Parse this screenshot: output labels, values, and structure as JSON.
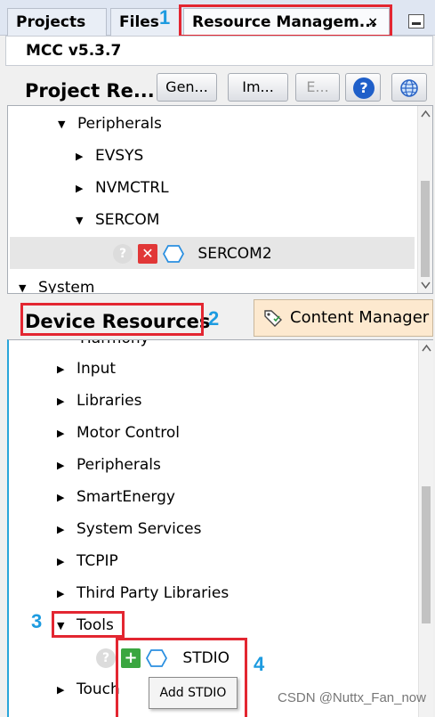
{
  "tabs": [
    {
      "label": "Projects"
    },
    {
      "label": "Files"
    },
    {
      "label": "Resource Managem...",
      "close": "×",
      "active": true
    }
  ],
  "version": "MCC v5.3.7",
  "project_resources": {
    "title": "Project Re...",
    "buttons": [
      {
        "label": "Gen...",
        "enabled": true
      },
      {
        "label": "Im...",
        "enabled": true
      },
      {
        "label": "E...",
        "enabled": false
      }
    ],
    "icons": [
      "help-icon",
      "globe-icon"
    ],
    "help_glyph": "?",
    "tree": [
      {
        "label": "Peripherals",
        "expanded": true
      },
      {
        "label": "EVSYS",
        "expanded": false
      },
      {
        "label": "NVMCTRL",
        "expanded": false
      },
      {
        "label": "SERCOM",
        "expanded": true
      },
      {
        "label": "System",
        "expanded": true
      }
    ],
    "component": {
      "label": "SERCOM2",
      "icons": [
        "disabled-info-icon",
        "remove-icon",
        "hexagon-icon"
      ],
      "remove_glyph": "✕"
    }
  },
  "device_resources": {
    "title": "Device Resources",
    "content_manager_label": "Content Manager",
    "tree": [
      {
        "label": "Harmony"
      },
      {
        "label": "Input"
      },
      {
        "label": "Libraries"
      },
      {
        "label": "Motor Control"
      },
      {
        "label": "Peripherals"
      },
      {
        "label": "SmartEnergy"
      },
      {
        "label": "System Services"
      },
      {
        "label": "TCPIP"
      },
      {
        "label": "Third Party Libraries"
      },
      {
        "label": "Tools",
        "expanded": true
      },
      {
        "label": "Touch"
      }
    ],
    "component": {
      "label": "STDIO",
      "icons": [
        "disabled-info-icon",
        "add-icon",
        "hexagon-icon"
      ],
      "add_glyph": "+"
    },
    "tooltip": "Add STDIO"
  },
  "callouts": [
    "1",
    "2",
    "3",
    "4"
  ],
  "watermark": "CSDN @Nuttx_Fan_now",
  "colors": {
    "highlight": "#e32631",
    "callout": "#1d9be0",
    "content_manager_bg": "#fde9cf",
    "add_green": "#3aa640",
    "remove_red": "#e13737"
  }
}
